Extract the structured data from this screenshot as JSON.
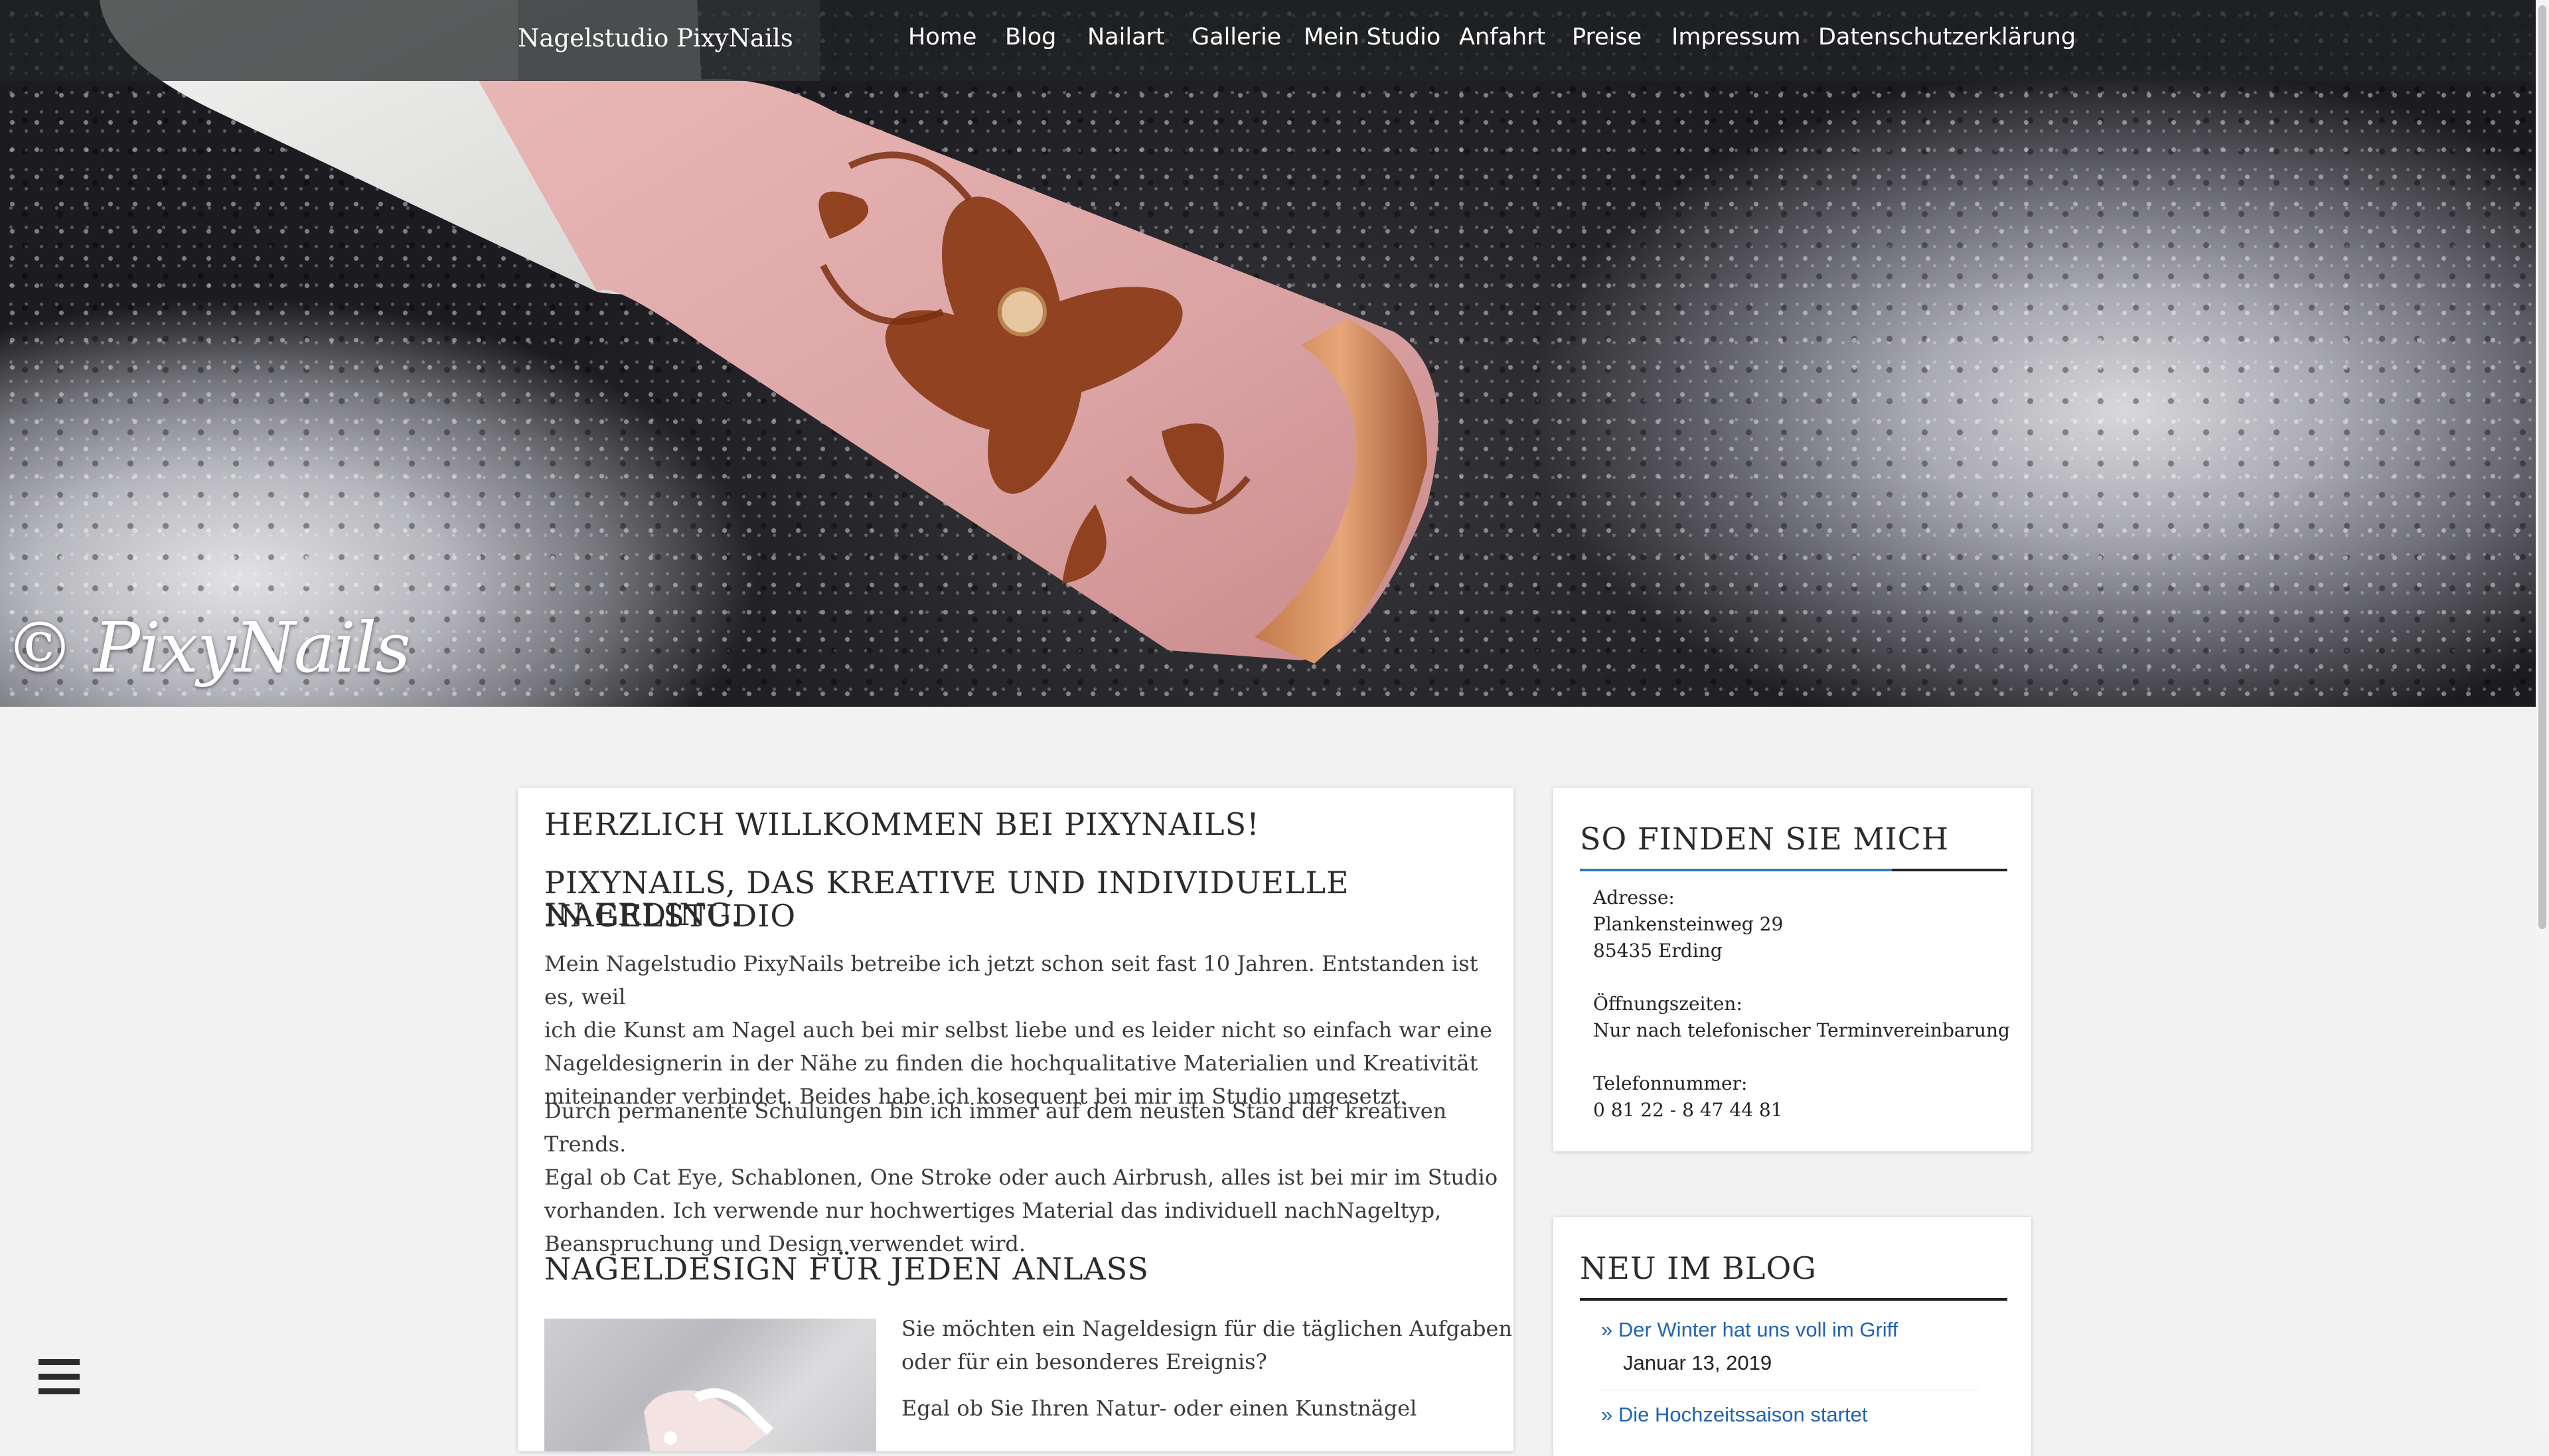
{
  "brand": "Nagelstudio PixyNails",
  "nav": [
    "Home",
    "Blog",
    "Nailart",
    "Gallerie",
    "Mein Studio",
    "Anfahrt",
    "Preise",
    "Impressum",
    "Datenschutzerklärung"
  ],
  "hero": {
    "watermark": "© PixyNails"
  },
  "main": {
    "title": "HERZLICH WILLKOMMEN BEI PIXYNAILS!",
    "subtitle_line1": "PIXYNAILS, DAS KREATIVE UND INDIVIDUELLE NAGELSTUDIO",
    "subtitle_line2": "IN ERDING.",
    "p1": [
      "Mein Nagelstudio PixyNails betreibe ich jetzt schon seit fast 10 Jahren. Entstanden ist es, weil",
      "ich die Kunst am Nagel auch bei mir selbst liebe und es leider nicht so einfach war eine",
      "Nageldesignerin in der Nähe zu finden die hochqualitative Materialien und Kreativität",
      "miteinander verbindet. Beides habe ich kosequent bei mir im Studio umgesetzt."
    ],
    "p2": [
      "Durch permanente Schulungen bin ich immer auf dem neusten Stand der kreativen Trends.",
      "Egal ob Cat Eye, Schablonen, One Stroke oder auch Airbrush, alles ist bei mir im Studio",
      "vorhanden. Ich verwende nur hochwertiges Material das individuell nachNageltyp,",
      "Beanspruchung und Design verwendet wird."
    ],
    "section_title": "NAGELDESIGN FÜR JEDEN ANLASS",
    "p3": [
      "Sie möchten ein Nageldesign für die täglichen Aufgaben",
      "oder für ein besonderes Ereignis?"
    ],
    "p4": "Egal ob Sie Ihren Natur- oder einen  Kunstnägel"
  },
  "find": {
    "title": "SO FINDEN SIE MICH",
    "address_label": "Adresse:",
    "address_street": "Plankensteinweg 29",
    "address_city": "85435 Erding",
    "hours_label": "Öffnungszeiten:",
    "hours_value": "Nur nach telefonischer Terminvereinbarung",
    "phone_label": "Telefonnummer:",
    "phone_value": "0 81 22 - 8 47 44 81"
  },
  "blog": {
    "title": "NEU IM BLOG",
    "posts": [
      {
        "title": "Der Winter hat uns voll im Griff",
        "date": "Januar 13, 2019"
      },
      {
        "title": "Die Hochzeitssaison startet",
        "date": ""
      }
    ]
  },
  "colors": {
    "accent_blue": "#2e7cc0",
    "link_blue": "#1f63b3",
    "navbar": "#202224"
  }
}
